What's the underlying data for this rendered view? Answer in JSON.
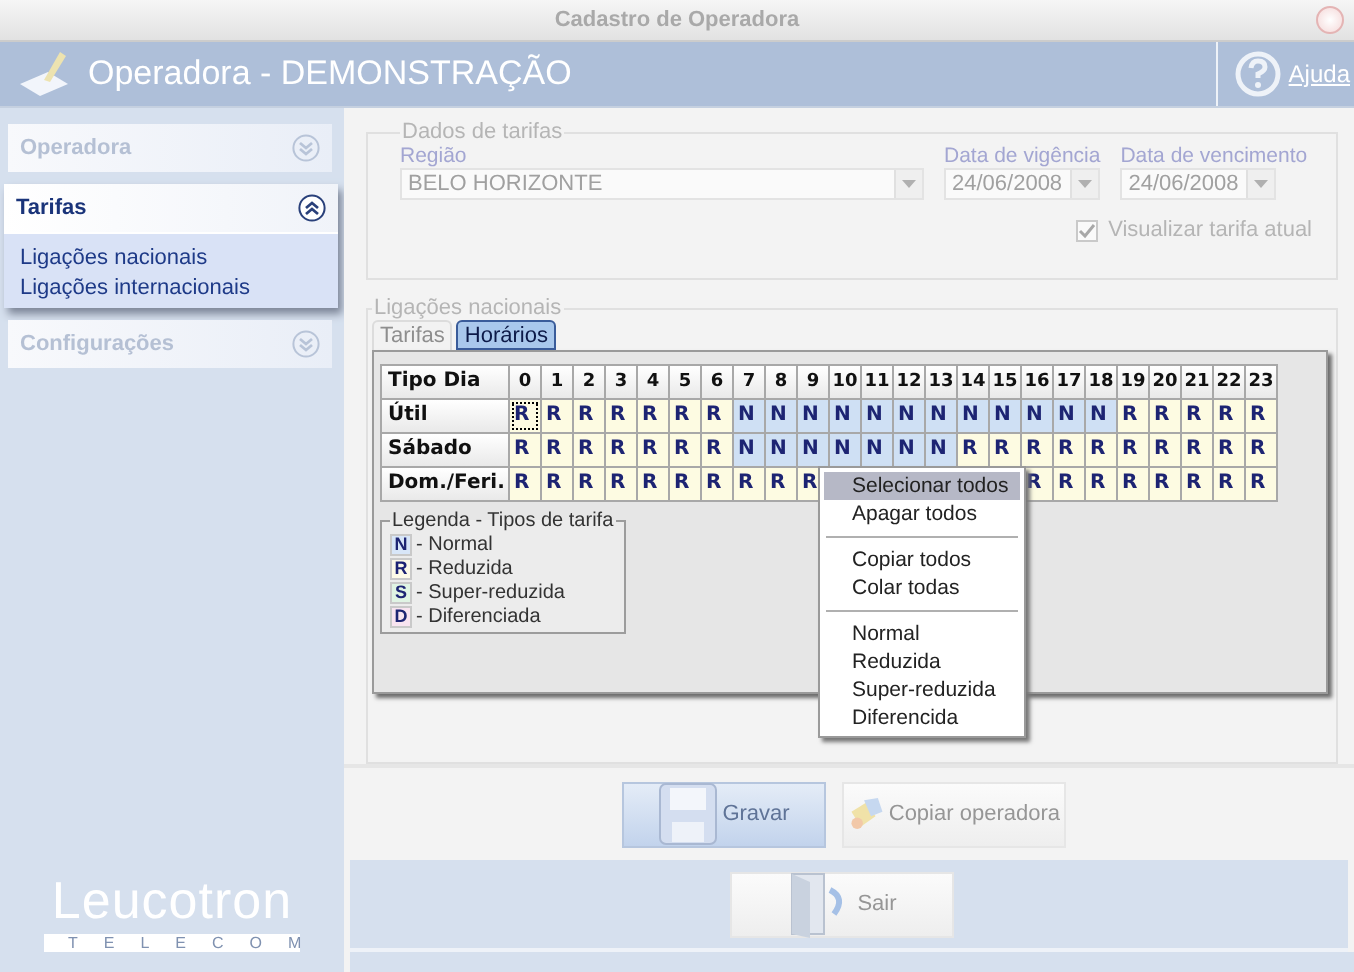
{
  "window": {
    "title": "Cadastro de Operadora"
  },
  "header": {
    "title": "Operadora - DEMONSTRAÇÃO",
    "help_label": "Ajuda"
  },
  "sidebar": {
    "sections": [
      {
        "label": "Operadora",
        "expanded": false
      },
      {
        "label": "Tarifas",
        "expanded": true,
        "items": [
          {
            "label": "Ligações nacionais"
          },
          {
            "label": "Ligações internacionais"
          }
        ]
      },
      {
        "label": "Configurações",
        "expanded": false
      }
    ],
    "logo": {
      "name": "Leucotron",
      "tagline": "TELECOM"
    }
  },
  "tariff_data": {
    "legend": "Dados de tarifas",
    "region": {
      "label": "Região",
      "value": "BELO HORIZONTE"
    },
    "start_date": {
      "label": "Data de vigência",
      "value": "24/06/2008"
    },
    "end_date": {
      "label": "Data de vencimento",
      "value": "24/06/2008"
    },
    "show_current": {
      "label": "Visualizar tarifa atual",
      "checked": true
    }
  },
  "schedule": {
    "legend": "Ligações nacionais",
    "tabs": [
      {
        "label": "Tarifas",
        "selected": false
      },
      {
        "label": "Horários",
        "selected": true
      }
    ],
    "corner": "Tipo Dia",
    "columns": [
      "0",
      "1",
      "2",
      "3",
      "4",
      "5",
      "6",
      "7",
      "8",
      "9",
      "10",
      "11",
      "12",
      "13",
      "14",
      "15",
      "16",
      "17",
      "18",
      "19",
      "20",
      "21",
      "22",
      "23"
    ],
    "rows": [
      {
        "label": "Útil",
        "cells": [
          {
            "value": "R",
            "kind": "reduced",
            "focused": true
          },
          {
            "value": "R",
            "kind": "reduced",
            "focused": false
          },
          {
            "value": "R",
            "kind": "reduced",
            "focused": false
          },
          {
            "value": "R",
            "kind": "reduced",
            "focused": false
          },
          {
            "value": "R",
            "kind": "reduced",
            "focused": false
          },
          {
            "value": "R",
            "kind": "reduced",
            "focused": false
          },
          {
            "value": "R",
            "kind": "reduced",
            "focused": false
          },
          {
            "value": "N",
            "kind": "normal",
            "focused": false
          },
          {
            "value": "N",
            "kind": "normal",
            "focused": false
          },
          {
            "value": "N",
            "kind": "normal",
            "focused": false
          },
          {
            "value": "N",
            "kind": "normal",
            "focused": false
          },
          {
            "value": "N",
            "kind": "normal",
            "focused": false
          },
          {
            "value": "N",
            "kind": "normal",
            "focused": false
          },
          {
            "value": "N",
            "kind": "normal",
            "focused": false
          },
          {
            "value": "N",
            "kind": "normal",
            "focused": false
          },
          {
            "value": "N",
            "kind": "normal",
            "focused": false
          },
          {
            "value": "N",
            "kind": "normal",
            "focused": false
          },
          {
            "value": "N",
            "kind": "normal",
            "focused": false
          },
          {
            "value": "N",
            "kind": "normal",
            "focused": false
          },
          {
            "value": "R",
            "kind": "reduced",
            "focused": false
          },
          {
            "value": "R",
            "kind": "reduced",
            "focused": false
          },
          {
            "value": "R",
            "kind": "reduced",
            "focused": false
          },
          {
            "value": "R",
            "kind": "reduced",
            "focused": false
          },
          {
            "value": "R",
            "kind": "reduced",
            "focused": false
          }
        ]
      },
      {
        "label": "Sábado",
        "cells": [
          {
            "value": "R",
            "kind": "reduced",
            "focused": false
          },
          {
            "value": "R",
            "kind": "reduced",
            "focused": false
          },
          {
            "value": "R",
            "kind": "reduced",
            "focused": false
          },
          {
            "value": "R",
            "kind": "reduced",
            "focused": false
          },
          {
            "value": "R",
            "kind": "reduced",
            "focused": false
          },
          {
            "value": "R",
            "kind": "reduced",
            "focused": false
          },
          {
            "value": "R",
            "kind": "reduced",
            "focused": false
          },
          {
            "value": "N",
            "kind": "normal",
            "focused": false
          },
          {
            "value": "N",
            "kind": "normal",
            "focused": false
          },
          {
            "value": "N",
            "kind": "normal",
            "focused": false
          },
          {
            "value": "N",
            "kind": "normal",
            "focused": false
          },
          {
            "value": "N",
            "kind": "normal",
            "focused": false
          },
          {
            "value": "N",
            "kind": "normal",
            "focused": false
          },
          {
            "value": "N",
            "kind": "normal",
            "focused": false
          },
          {
            "value": "R",
            "kind": "reduced",
            "focused": false
          },
          {
            "value": "R",
            "kind": "reduced",
            "focused": false
          },
          {
            "value": "R",
            "kind": "reduced",
            "focused": false
          },
          {
            "value": "R",
            "kind": "reduced",
            "focused": false
          },
          {
            "value": "R",
            "kind": "reduced",
            "focused": false
          },
          {
            "value": "R",
            "kind": "reduced",
            "focused": false
          },
          {
            "value": "R",
            "kind": "reduced",
            "focused": false
          },
          {
            "value": "R",
            "kind": "reduced",
            "focused": false
          },
          {
            "value": "R",
            "kind": "reduced",
            "focused": false
          },
          {
            "value": "R",
            "kind": "reduced",
            "focused": false
          }
        ]
      },
      {
        "label": "Dom./Feri.",
        "cells": [
          {
            "value": "R",
            "kind": "reduced",
            "focused": false
          },
          {
            "value": "R",
            "kind": "reduced",
            "focused": false
          },
          {
            "value": "R",
            "kind": "reduced",
            "focused": false
          },
          {
            "value": "R",
            "kind": "reduced",
            "focused": false
          },
          {
            "value": "R",
            "kind": "reduced",
            "focused": false
          },
          {
            "value": "R",
            "kind": "reduced",
            "focused": false
          },
          {
            "value": "R",
            "kind": "reduced",
            "focused": false
          },
          {
            "value": "R",
            "kind": "reduced",
            "focused": false
          },
          {
            "value": "R",
            "kind": "reduced",
            "focused": false
          },
          {
            "value": "R",
            "kind": "reduced",
            "focused": false
          },
          null,
          null,
          null,
          null,
          null,
          null,
          {
            "value": "R",
            "kind": "reduced",
            "focused": false
          },
          {
            "value": "R",
            "kind": "reduced",
            "focused": false
          },
          {
            "value": "R",
            "kind": "reduced",
            "focused": false
          },
          {
            "value": "R",
            "kind": "reduced",
            "focused": false
          },
          {
            "value": "R",
            "kind": "reduced",
            "focused": false
          },
          {
            "value": "R",
            "kind": "reduced",
            "focused": false
          },
          {
            "value": "R",
            "kind": "reduced",
            "focused": false
          },
          {
            "value": "R",
            "kind": "reduced",
            "focused": false
          }
        ]
      }
    ],
    "legend_title": "Legenda - Tipos de tarifa",
    "legend_items": [
      {
        "code": "N",
        "label": "- Normal",
        "kind": "normal"
      },
      {
        "code": "R",
        "label": "- Reduzida",
        "kind": "reduced"
      },
      {
        "code": "S",
        "label": "- Super-reduzida",
        "kind": "super"
      },
      {
        "code": "D",
        "label": "- Diferenciada",
        "kind": "special"
      }
    ]
  },
  "context_menu": [
    {
      "kind": "item",
      "label": "Selecionar todos",
      "selected": true
    },
    {
      "kind": "item",
      "label": "Apagar todos",
      "selected": false
    },
    {
      "kind": "separator"
    },
    {
      "kind": "item",
      "label": "Copiar todos",
      "selected": false
    },
    {
      "kind": "item",
      "label": "Colar todas",
      "selected": false
    },
    {
      "kind": "separator"
    },
    {
      "kind": "item",
      "label": "Normal",
      "selected": false
    },
    {
      "kind": "item",
      "label": "Reduzida",
      "selected": false
    },
    {
      "kind": "item",
      "label": "Super-reduzida",
      "selected": false
    },
    {
      "kind": "item",
      "label": "Diferencida",
      "selected": false
    }
  ],
  "actions": [
    {
      "label": "Gravar",
      "kind": "save",
      "pressed": true
    },
    {
      "label": "Copiar operadora",
      "kind": "copy",
      "pressed": false
    }
  ],
  "exit": {
    "label": "Sair"
  }
}
